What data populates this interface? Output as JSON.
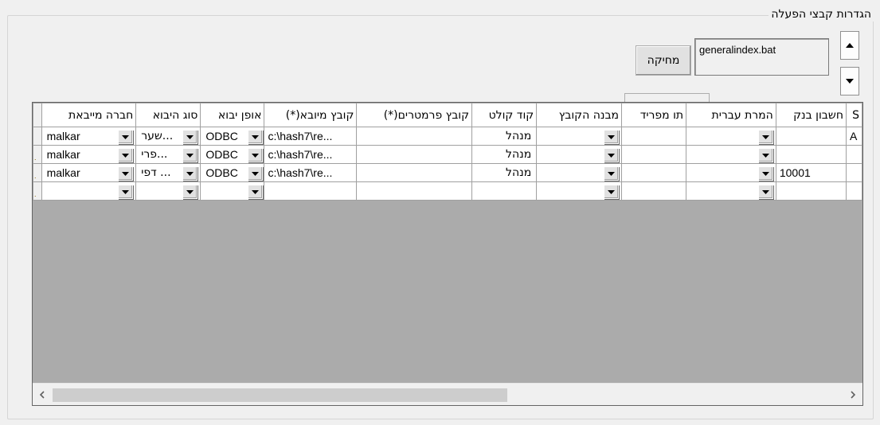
{
  "group": {
    "title": "הגדרות קבצי הפעלה"
  },
  "file_list": {
    "selected_item": "generalindex.bat"
  },
  "delete_button": {
    "label": "מחיקה"
  },
  "grid": {
    "columns": [
      "חברה מייבאת",
      "סוג היבוא",
      "אופן יבוא",
      "קובץ מיובא(*)",
      "קובץ פרמטרים(*)",
      "קוד קולט",
      "מבנה הקובץ",
      "תו מפריד",
      "המרת עברית",
      "חשבון בנק",
      "S"
    ],
    "rows": [
      {
        "company": "malkar",
        "import_type": "...שער",
        "import_mode": "ODBC",
        "imported_file": "c:\\hash7\\re...",
        "params_file": "",
        "collector_code": "מנהל",
        "file_structure": "",
        "separator": "",
        "hebrew_conv": "",
        "bank_account": "",
        "extra": "A"
      },
      {
        "company": "malkar",
        "import_type": "...פרי",
        "import_mode": "ODBC",
        "imported_file": "c:\\hash7\\re...",
        "params_file": "",
        "collector_code": "מנהל",
        "file_structure": "",
        "separator": "",
        "hebrew_conv": "",
        "bank_account": "",
        "extra": ""
      },
      {
        "company": "malkar",
        "import_type": "... דפי",
        "import_mode": "ODBC",
        "imported_file": "c:\\hash7\\re...",
        "params_file": "",
        "collector_code": "מנהל",
        "file_structure": "",
        "separator": "",
        "hebrew_conv": "",
        "bank_account": "10001",
        "extra": ""
      },
      {
        "company": "",
        "import_type": "",
        "import_mode": "",
        "imported_file": "",
        "params_file": "",
        "collector_code": "",
        "file_structure": "",
        "separator": "",
        "hebrew_conv": "",
        "bank_account": "",
        "extra": ""
      }
    ]
  },
  "icons": {
    "dropdown": "dropdown-arrow-icon",
    "scroll_left": "chevron-left-icon",
    "scroll_right": "chevron-right-icon",
    "spin_up": "arrow-up-icon",
    "spin_down": "arrow-down-icon"
  }
}
